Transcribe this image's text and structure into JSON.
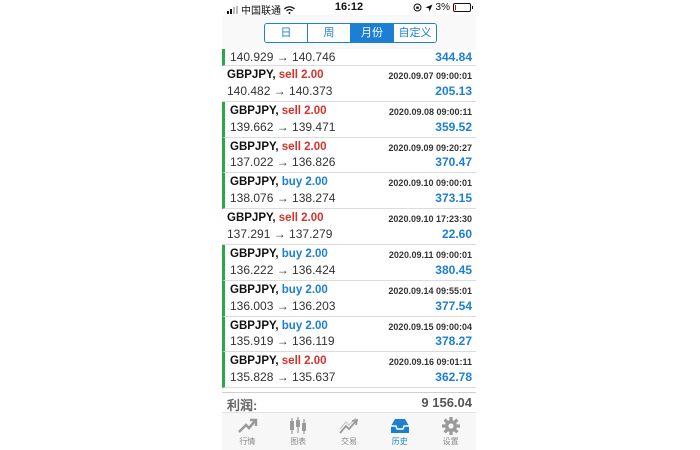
{
  "statusbar": {
    "carrier": "中国联通",
    "time": "16:12",
    "battery": "3%"
  },
  "segments": [
    {
      "label": "日",
      "active": false
    },
    {
      "label": "周",
      "active": false
    },
    {
      "label": "月份",
      "active": true
    },
    {
      "label": "自定义",
      "active": false
    }
  ],
  "first_row": {
    "prices": "140.929 → 140.746",
    "pnl": "344.84"
  },
  "trades": [
    {
      "symbol": "GBPJPY,",
      "dir": "sell 2.00",
      "type": "sell",
      "time": "2020.09.07 09:00:01",
      "prices": "140.482 → 140.373",
      "pnl": "205.13",
      "bar": false
    },
    {
      "symbol": "GBPJPY,",
      "dir": "sell 2.00",
      "type": "sell",
      "time": "2020.09.08 09:00:11",
      "prices": "139.662 → 139.471",
      "pnl": "359.52",
      "bar": true
    },
    {
      "symbol": "GBPJPY,",
      "dir": "sell 2.00",
      "type": "sell",
      "time": "2020.09.09 09:20:27",
      "prices": "137.022 → 136.826",
      "pnl": "370.47",
      "bar": true
    },
    {
      "symbol": "GBPJPY,",
      "dir": "buy 2.00",
      "type": "buy",
      "time": "2020.09.10 09:00:01",
      "prices": "138.076 → 138.274",
      "pnl": "373.15",
      "bar": true
    },
    {
      "symbol": "GBPJPY,",
      "dir": "sell 2.00",
      "type": "sell",
      "time": "2020.09.10 17:23:30",
      "prices": "137.291 → 137.279",
      "pnl": "22.60",
      "bar": false
    },
    {
      "symbol": "GBPJPY,",
      "dir": "buy 2.00",
      "type": "buy",
      "time": "2020.09.11 09:00:01",
      "prices": "136.222 → 136.424",
      "pnl": "380.45",
      "bar": true
    },
    {
      "symbol": "GBPJPY,",
      "dir": "buy 2.00",
      "type": "buy",
      "time": "2020.09.14 09:55:01",
      "prices": "136.003 → 136.203",
      "pnl": "377.54",
      "bar": true
    },
    {
      "symbol": "GBPJPY,",
      "dir": "buy 2.00",
      "type": "buy",
      "time": "2020.09.15 09:00:04",
      "prices": "135.919 → 136.119",
      "pnl": "378.27",
      "bar": true
    },
    {
      "symbol": "GBPJPY,",
      "dir": "sell 2.00",
      "type": "sell",
      "time": "2020.09.16 09:01:11",
      "prices": "135.828 → 135.637",
      "pnl": "362.78",
      "bar": true
    }
  ],
  "total": {
    "label": "利润:",
    "value": "9 156.04"
  },
  "tabs": [
    {
      "label": "行情",
      "icon": "quotes-icon",
      "active": false
    },
    {
      "label": "图表",
      "icon": "chart-icon",
      "active": false
    },
    {
      "label": "交易",
      "icon": "trade-icon",
      "active": false
    },
    {
      "label": "历史",
      "icon": "history-icon",
      "active": true
    },
    {
      "label": "设置",
      "icon": "settings-icon",
      "active": false
    }
  ],
  "colors": {
    "accent": "#1d7fd3",
    "sell": "#d6322b",
    "profit_bar": "#2aa845"
  }
}
